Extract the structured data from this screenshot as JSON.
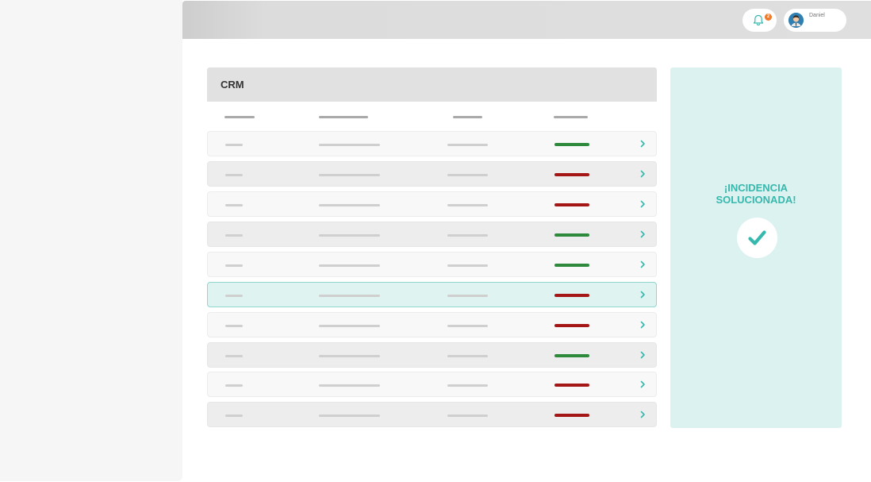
{
  "header": {
    "notification_count": "2",
    "user_name": "Daniel"
  },
  "crm": {
    "title": "CRM",
    "rows": [
      {
        "status": "green"
      },
      {
        "status": "red"
      },
      {
        "status": "red"
      },
      {
        "status": "green"
      },
      {
        "status": "green"
      },
      {
        "status": "red",
        "highlighted": true
      },
      {
        "status": "red"
      },
      {
        "status": "green"
      },
      {
        "status": "red"
      },
      {
        "status": "red"
      }
    ]
  },
  "incident": {
    "line1": "¡INCIDENCIA",
    "line2": "SOLUCIONADA!"
  },
  "colors": {
    "accent": "#37b8ad",
    "status_green": "#2d8a3d",
    "status_red": "#a51717",
    "notification_badge": "#f07a2c"
  },
  "icons": [
    "bell-icon",
    "avatar",
    "chevron-right-icon",
    "check-icon"
  ]
}
